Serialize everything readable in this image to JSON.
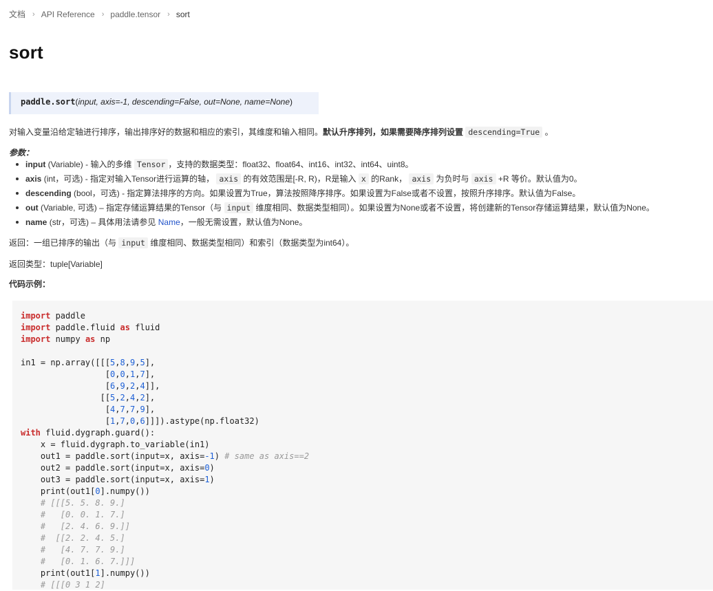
{
  "breadcrumb": {
    "items": [
      "文档",
      "API Reference",
      "paddle.tensor"
    ],
    "current": "sort"
  },
  "page_title": "sort",
  "signature": {
    "fn": "paddle.sort",
    "args": "input, axis=-1, descending=False, out=None, name=None"
  },
  "description": {
    "text": "对输入变量沿给定轴进行排序，输出排序好的数据和相应的索引，其维度和输入相同。",
    "bold": "默认升序排列，如果需要降序排列设置",
    "code": "descending=True",
    "tail": "。"
  },
  "params_label": "参数：",
  "params": [
    {
      "name": "input",
      "type": "(Variable)",
      "pre": "- 输入的多维",
      "code1": "Tensor",
      "post": "，支持的数据类型：float32、float64、int16、int32、int64、uint8。"
    },
    {
      "name": "axis",
      "type": "(int，可选)",
      "pre": "- 指定对输入Tensor进行运算的轴，",
      "code1": "axis",
      "mid": "的有效范围是[-R, R)，R是输入",
      "code2": "x",
      "mid2": "的Rank，",
      "code3": "axis",
      "post": "为负时与",
      "code4": "axis",
      "post2": "+R 等价。默认值为0。"
    },
    {
      "name": "descending",
      "type": "(bool，可选)",
      "pre": "- 指定算法排序的方向。如果设置为True，算法按照降序排序。如果设置为False或者不设置，按照升序排序。默认值为False。"
    },
    {
      "name": "out",
      "type": "(Variable, 可选)",
      "pre": "– 指定存储运算结果的Tensor（与",
      "code1": "input",
      "post": "维度相同、数据类型相同）。如果设置为None或者不设置，将创建新的Tensor存储运算结果，默认值为None。"
    },
    {
      "name": "name",
      "type": "(str，可选)",
      "pre": "– 具体用法请参见",
      "link": "Name",
      "post": "，一般无需设置，默认值为None。"
    }
  ],
  "returns": {
    "pre": "返回：一组已排序的输出（与",
    "code": "input",
    "post": "维度相同、数据类型相同）和索引（数据类型为int64）。"
  },
  "return_type": "返回类型：tuple[Variable]",
  "example_label": "代码示例："
}
